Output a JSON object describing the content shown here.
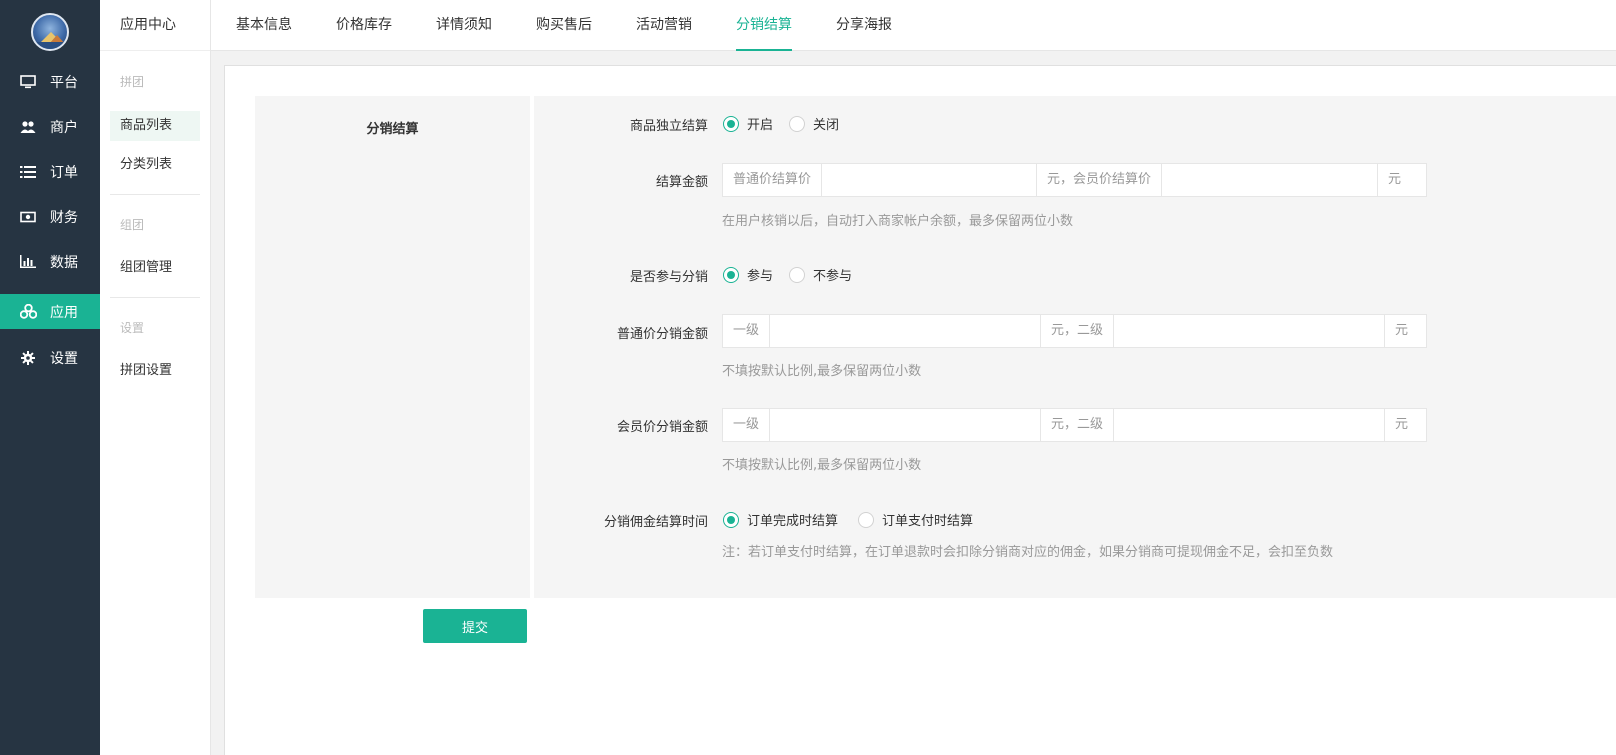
{
  "sidebar": {
    "items": [
      {
        "label": "平台",
        "icon": "monitor-icon"
      },
      {
        "label": "商户",
        "icon": "users-icon"
      },
      {
        "label": "订单",
        "icon": "list-icon"
      },
      {
        "label": "财务",
        "icon": "money-icon"
      },
      {
        "label": "数据",
        "icon": "bar-chart-icon"
      },
      {
        "label": "应用",
        "icon": "apps-icon"
      },
      {
        "label": "设置",
        "icon": "gear-icon"
      }
    ],
    "active_color": "#1ab394",
    "bg_color": "#263442"
  },
  "subnav": {
    "title": "应用中心",
    "groups": [
      {
        "label": "拼团",
        "items": [
          "商品列表",
          "分类列表"
        ]
      },
      {
        "label": "组团",
        "items": [
          "组团管理"
        ]
      },
      {
        "label": "设置",
        "items": [
          "拼团设置"
        ]
      }
    ]
  },
  "tabs": [
    "基本信息",
    "价格库存",
    "详情须知",
    "购买售后",
    "活动营销",
    "分销结算",
    "分享海报"
  ],
  "section_title": "分销结算",
  "form": {
    "independent": {
      "label": "商品独立结算",
      "on": "开启",
      "off": "关闭"
    },
    "amount": {
      "label": "结算金额",
      "prefix": "普通价结算价",
      "middle": "元，会员价结算价",
      "suffix": "元",
      "hint": "在用户核销以后，自动打入商家帐户余额，最多保留两位小数"
    },
    "join": {
      "label": "是否参与分销",
      "yes": "参与",
      "no": "不参与"
    },
    "normal_commission": {
      "label": "普通价分销金额",
      "prefix": "一级",
      "middle": "元，二级",
      "suffix": "元",
      "hint": "不填按默认比例,最多保留两位小数"
    },
    "member_commission": {
      "label": "会员价分销金额",
      "prefix": "一级",
      "middle": "元，二级",
      "suffix": "元",
      "hint": "不填按默认比例,最多保留两位小数"
    },
    "settle_time": {
      "label": "分销佣金结算时间",
      "opt1": "订单完成时结算",
      "opt2": "订单支付时结算",
      "hint": "注：若订单支付时结算，在订单退款时会扣除分销商对应的佣金，如果分销商可提现佣金不足，会扣至负数"
    }
  },
  "submit_label": "提交",
  "accent_color": "#1ab394"
}
